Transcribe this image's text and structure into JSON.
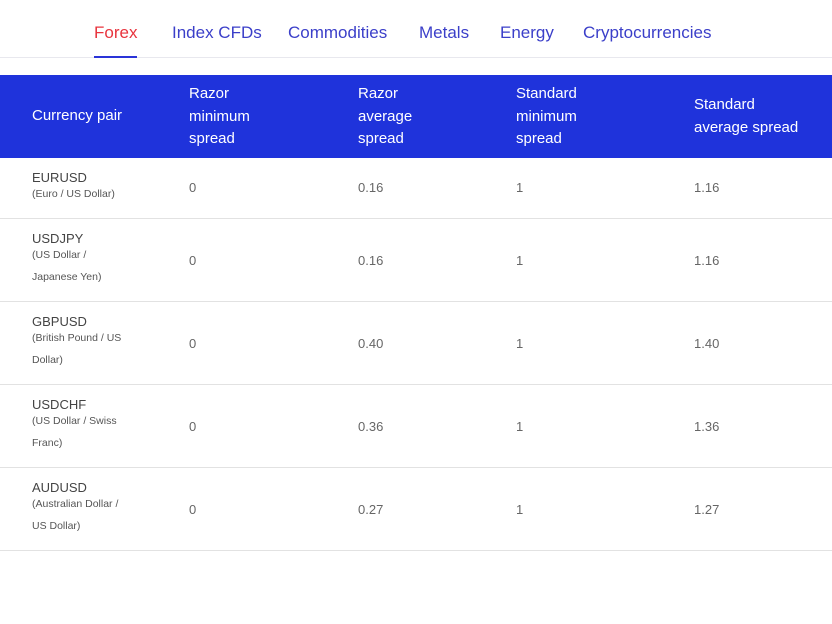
{
  "tabs": [
    {
      "label": "Forex",
      "active": true
    },
    {
      "label": "Index CFDs",
      "active": false
    },
    {
      "label": "Commodities",
      "active": false
    },
    {
      "label": "Metals",
      "active": false
    },
    {
      "label": "Energy",
      "active": false
    },
    {
      "label": "Cryptocurrencies",
      "active": false
    }
  ],
  "table": {
    "headers": [
      "Currency pair",
      "Razor\nminimum\nspread",
      "Razor\naverage\nspread",
      "Standard\nminimum\nspread",
      "Standard\naverage spread"
    ],
    "rows": [
      {
        "pair": "EURUSD",
        "name": "(Euro / US Dollar)",
        "razor_min": "0",
        "razor_avg": "0.16",
        "std_min": "1",
        "std_avg": "1.16"
      },
      {
        "pair": "USDJPY",
        "name": "(US Dollar / Japanese Yen)",
        "razor_min": "0",
        "razor_avg": "0.16",
        "std_min": "1",
        "std_avg": "1.16"
      },
      {
        "pair": "GBPUSD",
        "name": "(British Pound / US Dollar)",
        "razor_min": "0",
        "razor_avg": "0.40",
        "std_min": "1",
        "std_avg": "1.40"
      },
      {
        "pair": "USDCHF",
        "name": "(US Dollar / Swiss Franc)",
        "razor_min": "0",
        "razor_avg": "0.36",
        "std_min": "1",
        "std_avg": "1.36"
      },
      {
        "pair": "AUDUSD",
        "name": "(Australian Dollar / US Dollar)",
        "razor_min": "0",
        "razor_avg": "0.27",
        "std_min": "1",
        "std_avg": "1.27"
      }
    ]
  },
  "colors": {
    "accent_blue": "#1f33db",
    "active_tab": "#e8343e",
    "tab_text": "#3b3fc9"
  }
}
